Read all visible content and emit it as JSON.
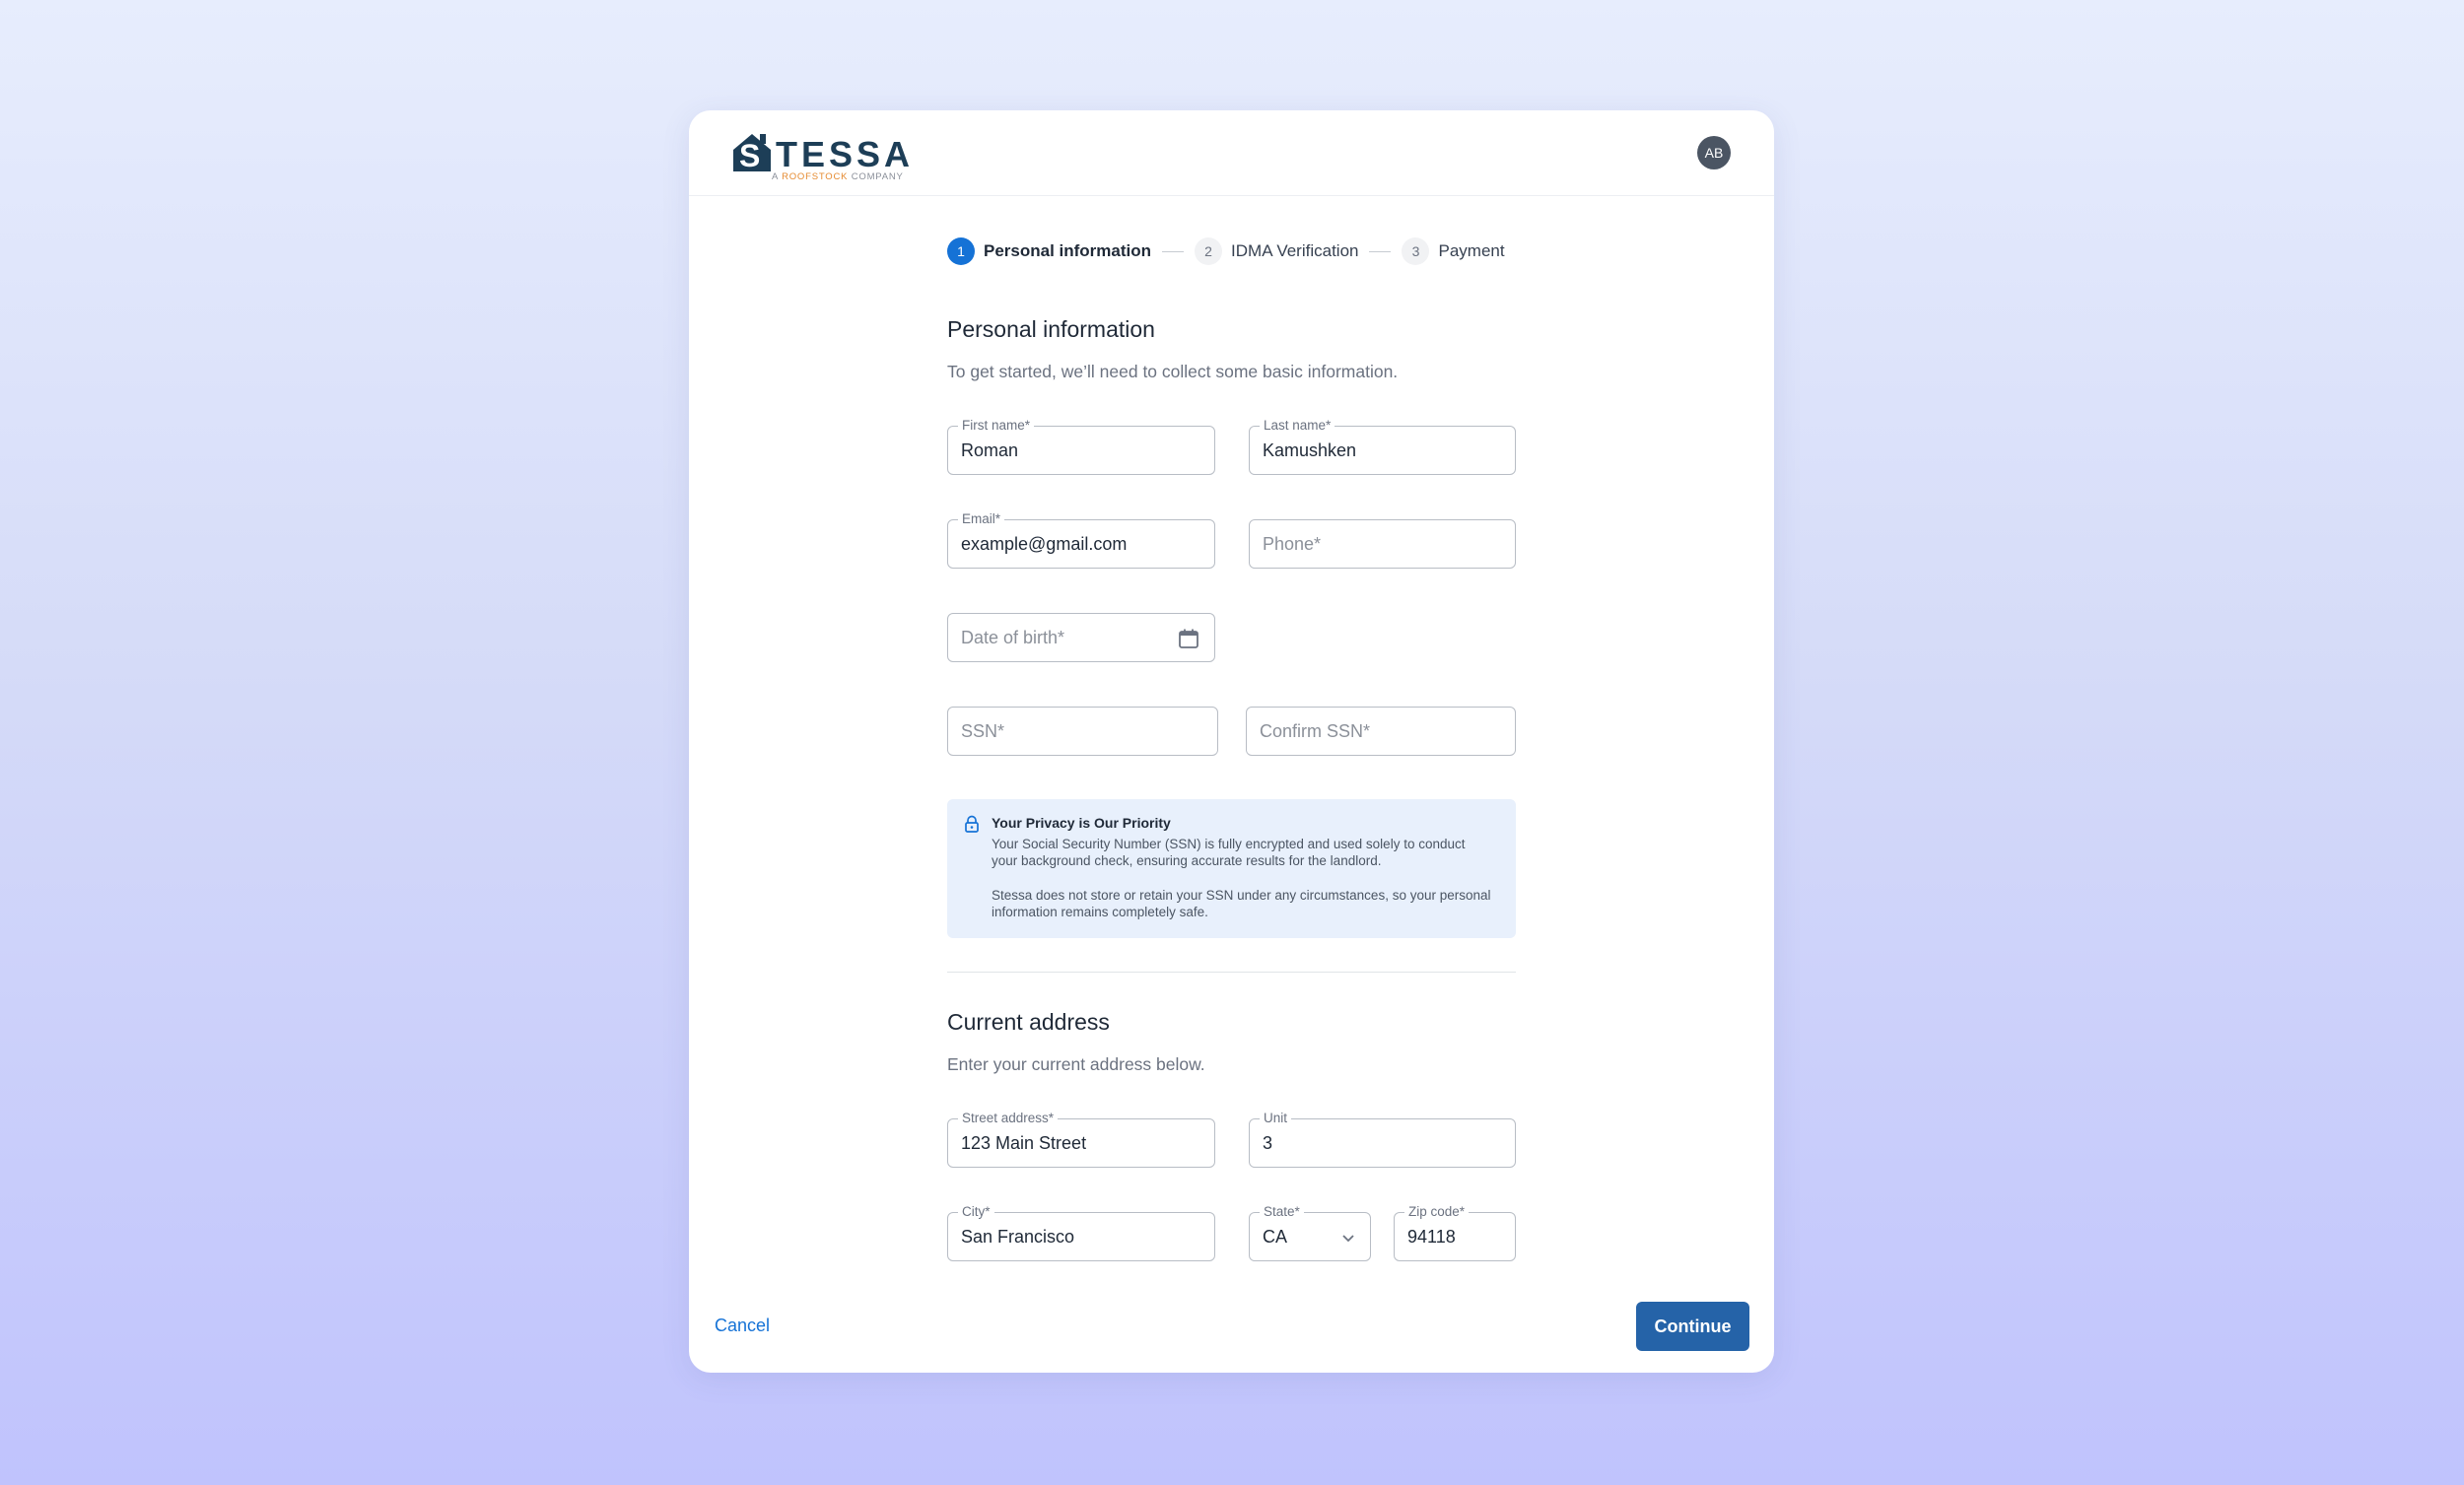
{
  "brand": {
    "name": "TESSA",
    "initial": "S",
    "tagline_prefix": "A",
    "tagline_accent": "ROOFSTOCK",
    "tagline_suffix": "COMPANY",
    "colors": {
      "navy": "#1d3e57",
      "accent": "#e58a2f"
    }
  },
  "user": {
    "initials": "AB"
  },
  "stepper": [
    {
      "number": "1",
      "label": "Personal information",
      "active": true
    },
    {
      "number": "2",
      "label": "IDMA Verification",
      "active": false
    },
    {
      "number": "3",
      "label": "Payment",
      "active": false
    }
  ],
  "personal": {
    "title": "Personal information",
    "subtitle": "To get started, we’ll need to collect some basic information.",
    "first_name": {
      "label": "First name*",
      "value": "Roman"
    },
    "last_name": {
      "label": "Last name*",
      "value": "Kamushken"
    },
    "email": {
      "label": "Email*",
      "value": "example@gmail.com"
    },
    "phone": {
      "placeholder": "Phone*"
    },
    "dob": {
      "placeholder": "Date of birth*",
      "icon": "calendar-icon"
    },
    "ssn": {
      "placeholder": "SSN*"
    },
    "confirm_ssn": {
      "placeholder": "Confirm SSN*"
    }
  },
  "privacy": {
    "icon": "lock-icon",
    "title": "Your Privacy is Our Priority",
    "text1": "Your Social Security Number (SSN) is fully encrypted and used solely to conduct your background check, ensuring accurate results for the landlord.",
    "text2": "Stessa does not store or retain your SSN under any circumstances, so your personal information remains completely safe."
  },
  "address": {
    "title": "Current address",
    "subtitle": "Enter your current address below.",
    "street": {
      "label": "Street address*",
      "value": "123 Main Street"
    },
    "unit": {
      "label": "Unit",
      "value": "3"
    },
    "city": {
      "label": "City*",
      "value": "San Francisco"
    },
    "state": {
      "label": "State*",
      "value": "CA"
    },
    "zip": {
      "label": "Zip code*",
      "value": "94118"
    }
  },
  "footer": {
    "cancel": "Cancel",
    "continue": "Continue"
  },
  "colors": {
    "primary": "#1572d6",
    "button": "#2563a8",
    "info_bg": "#e8f0fc"
  }
}
